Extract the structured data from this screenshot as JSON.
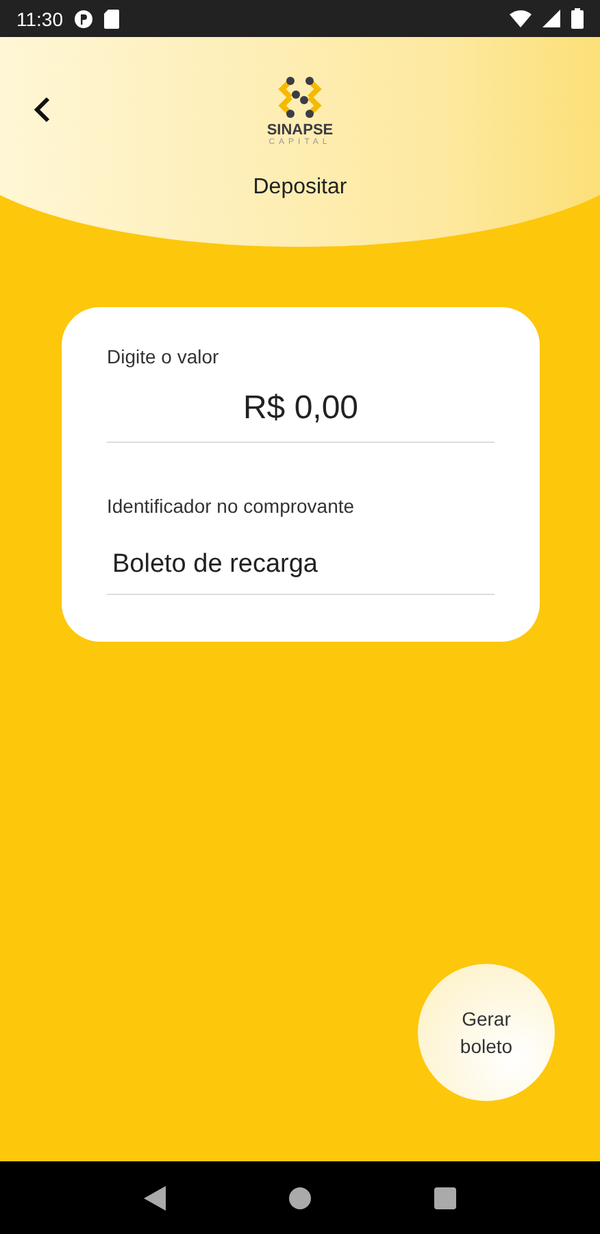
{
  "status_bar": {
    "time": "11:30"
  },
  "header": {
    "logo": {
      "name": "SINAPSE",
      "subtitle": "CAPITAL"
    },
    "title": "Depositar"
  },
  "form": {
    "fields": [
      {
        "label": "Digite o valor",
        "value": "R$ 0,00",
        "kind": "amount"
      },
      {
        "label": "Identificador no comprovante",
        "value": "Boleto de recarga",
        "kind": "text"
      }
    ]
  },
  "action_button": {
    "label": "Gerar boleto"
  }
}
